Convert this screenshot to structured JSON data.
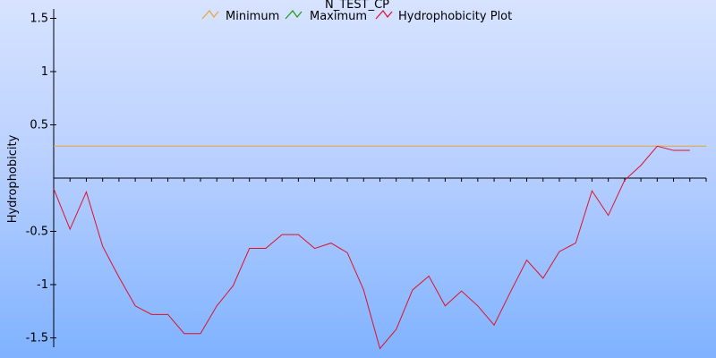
{
  "chart_data": {
    "type": "line",
    "title": "N_TEST_CP",
    "xlabel": "",
    "ylabel": "Hydrophobicity",
    "ylim": [
      -1.6,
      1.6
    ],
    "yticks": [
      1.5,
      1,
      0.5,
      -0.5,
      -1,
      -1.5
    ],
    "ytick_labels": [
      "1.5",
      "1",
      "0.5",
      "-0.5",
      "-1",
      "-1.5"
    ],
    "x_count": 41,
    "legend": {
      "placement": "top",
      "entries": [
        {
          "name": "Minimum",
          "color": "#e7a23a"
        },
        {
          "name": "Maximum",
          "color": "#1a9a1a"
        },
        {
          "name": "Hydrophobicity Plot",
          "color": "#e0102a"
        }
      ]
    },
    "series": [
      {
        "name": "Minimum",
        "color": "#e7a23a",
        "values": [
          0.3,
          0.3,
          0.3,
          0.3,
          0.3,
          0.3,
          0.3,
          0.3,
          0.3,
          0.3,
          0.3,
          0.3,
          0.3,
          0.3,
          0.3,
          0.3,
          0.3,
          0.3,
          0.3,
          0.3,
          0.3,
          0.3,
          0.3,
          0.3,
          0.3,
          0.3,
          0.3,
          0.3,
          0.3,
          0.3,
          0.3,
          0.3,
          0.3,
          0.3,
          0.3,
          0.3,
          0.3,
          0.3,
          0.3,
          0.3,
          0.3
        ]
      },
      {
        "name": "Hydrophobicity Plot",
        "color": "#e0102a",
        "values": [
          -0.1,
          -0.48,
          -0.13,
          -0.64,
          -0.93,
          -1.2,
          -1.28,
          -1.28,
          -1.46,
          -1.46,
          -1.2,
          -1.01,
          -0.66,
          -0.66,
          -0.53,
          -0.53,
          -0.66,
          -0.61,
          -0.7,
          -1.05,
          -1.6,
          -1.42,
          -1.05,
          -0.92,
          -1.2,
          -1.06,
          -1.2,
          -1.38,
          -1.07,
          -0.77,
          -0.94,
          -0.69,
          -0.61,
          -0.12,
          -0.35,
          -0.02,
          0.12,
          0.3,
          0.26,
          0.26,
          null
        ]
      }
    ]
  }
}
